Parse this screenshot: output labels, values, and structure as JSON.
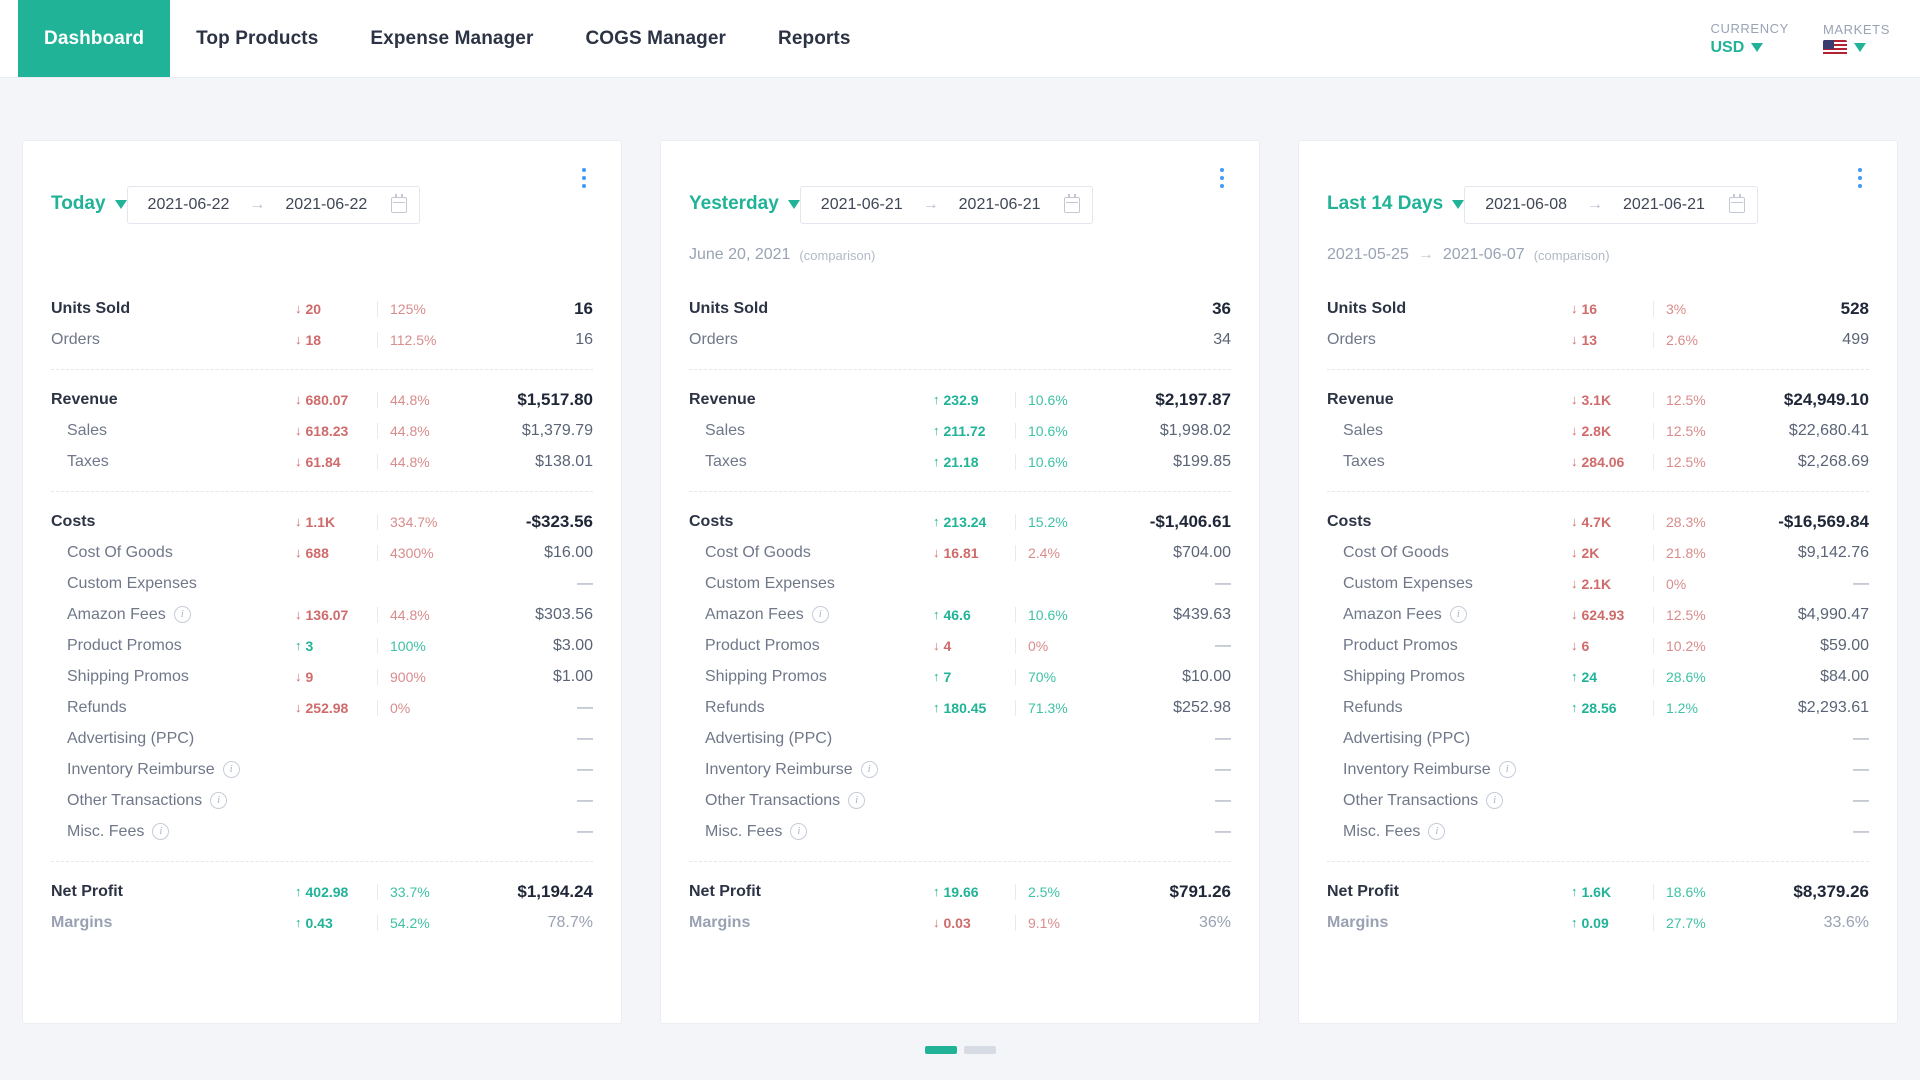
{
  "nav": {
    "tabs": [
      {
        "label": "Dashboard",
        "active": true
      },
      {
        "label": "Top Products",
        "active": false
      },
      {
        "label": "Expense Manager",
        "active": false
      },
      {
        "label": "COGS Manager",
        "active": false
      },
      {
        "label": "Reports",
        "active": false
      }
    ],
    "currency": {
      "label": "CURRENCY",
      "value": "USD"
    },
    "markets": {
      "label": "MARKETS",
      "value": "US"
    }
  },
  "colors": {
    "accent": "#20b397",
    "positive": "#20b397",
    "negative": "#cf6b6b",
    "menu_dot": "#3f9af8",
    "page_bg": "#f4f5f9"
  },
  "cards": [
    {
      "title": "Today",
      "date_from": "2021-06-22",
      "date_to": "2021-06-22",
      "range_arrow": "→",
      "comparison": null,
      "groups": [
        {
          "rows": [
            {
              "label": "Units Sold",
              "style": "main",
              "dir": "down",
              "delta": "20",
              "pct": "125%",
              "value": "16"
            },
            {
              "label": "Orders",
              "style": "sub-flat",
              "dir": "down",
              "delta": "18",
              "pct": "112.5%",
              "value": "16"
            }
          ]
        },
        {
          "rows": [
            {
              "label": "Revenue",
              "style": "main",
              "dir": "down",
              "delta": "680.07",
              "pct": "44.8%",
              "value": "$1,517.80"
            },
            {
              "label": "Sales",
              "style": "sub",
              "dir": "down",
              "delta": "618.23",
              "pct": "44.8%",
              "value": "$1,379.79"
            },
            {
              "label": "Taxes",
              "style": "sub",
              "dir": "down",
              "delta": "61.84",
              "pct": "44.8%",
              "value": "$138.01"
            }
          ]
        },
        {
          "rows": [
            {
              "label": "Costs",
              "style": "main",
              "dir": "down",
              "delta": "1.1K",
              "pct": "334.7%",
              "value": "-$323.56"
            },
            {
              "label": "Cost Of Goods",
              "style": "sub",
              "dir": "down",
              "delta": "688",
              "pct": "4300%",
              "value": "$16.00"
            },
            {
              "label": "Custom Expenses",
              "style": "sub",
              "dir": null,
              "delta": "",
              "pct": "",
              "value": "—"
            },
            {
              "label": "Amazon Fees",
              "style": "sub",
              "info": true,
              "dir": "down",
              "delta": "136.07",
              "pct": "44.8%",
              "value": "$303.56"
            },
            {
              "label": "Product Promos",
              "style": "sub",
              "dir": "up",
              "delta": "3",
              "pct": "100%",
              "value": "$3.00"
            },
            {
              "label": "Shipping Promos",
              "style": "sub",
              "dir": "down",
              "delta": "9",
              "pct": "900%",
              "value": "$1.00"
            },
            {
              "label": "Refunds",
              "style": "sub",
              "dir": "down",
              "delta": "252.98",
              "pct": "0%",
              "value": "—"
            },
            {
              "label": "Advertising (PPC)",
              "style": "sub",
              "dir": null,
              "delta": "",
              "pct": "",
              "value": "—"
            },
            {
              "label": "Inventory Reimburse",
              "style": "sub",
              "info": true,
              "dir": null,
              "delta": "",
              "pct": "",
              "value": "—"
            },
            {
              "label": "Other Transactions",
              "style": "sub",
              "info": true,
              "dir": null,
              "delta": "",
              "pct": "",
              "value": "—"
            },
            {
              "label": "Misc. Fees",
              "style": "sub",
              "info": true,
              "dir": null,
              "delta": "",
              "pct": "",
              "value": "—"
            }
          ]
        },
        {
          "rows": [
            {
              "label": "Net Profit",
              "style": "main",
              "dir": "up",
              "delta": "402.98",
              "pct": "33.7%",
              "value": "$1,194.24"
            },
            {
              "label": "Margins",
              "style": "muted",
              "dir": "up",
              "delta": "0.43",
              "pct": "54.2%",
              "value": "78.7%"
            }
          ]
        }
      ]
    },
    {
      "title": "Yesterday",
      "date_from": "2021-06-21",
      "date_to": "2021-06-21",
      "range_arrow": "→",
      "comparison": {
        "text": "June 20, 2021",
        "note": "(comparison)"
      },
      "groups": [
        {
          "rows": [
            {
              "label": "Units Sold",
              "style": "main",
              "dir": null,
              "delta": "",
              "pct": "",
              "value": "36"
            },
            {
              "label": "Orders",
              "style": "sub-flat",
              "dir": null,
              "delta": "",
              "pct": "",
              "value": "34"
            }
          ]
        },
        {
          "rows": [
            {
              "label": "Revenue",
              "style": "main",
              "dir": "up",
              "delta": "232.9",
              "pct": "10.6%",
              "value": "$2,197.87"
            },
            {
              "label": "Sales",
              "style": "sub",
              "dir": "up",
              "delta": "211.72",
              "pct": "10.6%",
              "value": "$1,998.02"
            },
            {
              "label": "Taxes",
              "style": "sub",
              "dir": "up",
              "delta": "21.18",
              "pct": "10.6%",
              "value": "$199.85"
            }
          ]
        },
        {
          "rows": [
            {
              "label": "Costs",
              "style": "main",
              "dir": "up",
              "delta": "213.24",
              "pct": "15.2%",
              "value": "-$1,406.61"
            },
            {
              "label": "Cost Of Goods",
              "style": "sub",
              "dir": "down",
              "delta": "16.81",
              "pct": "2.4%",
              "value": "$704.00"
            },
            {
              "label": "Custom Expenses",
              "style": "sub",
              "dir": null,
              "delta": "",
              "pct": "",
              "value": "—"
            },
            {
              "label": "Amazon Fees",
              "style": "sub",
              "info": true,
              "dir": "up",
              "delta": "46.6",
              "pct": "10.6%",
              "value": "$439.63"
            },
            {
              "label": "Product Promos",
              "style": "sub",
              "dir": "down",
              "delta": "4",
              "pct": "0%",
              "value": "—"
            },
            {
              "label": "Shipping Promos",
              "style": "sub",
              "dir": "up",
              "delta": "7",
              "pct": "70%",
              "value": "$10.00"
            },
            {
              "label": "Refunds",
              "style": "sub",
              "dir": "up",
              "delta": "180.45",
              "pct": "71.3%",
              "value": "$252.98"
            },
            {
              "label": "Advertising (PPC)",
              "style": "sub",
              "dir": null,
              "delta": "",
              "pct": "",
              "value": "—"
            },
            {
              "label": "Inventory Reimburse",
              "style": "sub",
              "info": true,
              "dir": null,
              "delta": "",
              "pct": "",
              "value": "—"
            },
            {
              "label": "Other Transactions",
              "style": "sub",
              "info": true,
              "dir": null,
              "delta": "",
              "pct": "",
              "value": "—"
            },
            {
              "label": "Misc. Fees",
              "style": "sub",
              "info": true,
              "dir": null,
              "delta": "",
              "pct": "",
              "value": "—"
            }
          ]
        },
        {
          "rows": [
            {
              "label": "Net Profit",
              "style": "main",
              "dir": "up",
              "delta": "19.66",
              "pct": "2.5%",
              "value": "$791.26"
            },
            {
              "label": "Margins",
              "style": "muted",
              "dir": "down",
              "delta": "0.03",
              "pct": "9.1%",
              "value": "36%"
            }
          ]
        }
      ]
    },
    {
      "title": "Last 14 Days",
      "date_from": "2021-06-08",
      "date_to": "2021-06-21",
      "range_arrow": "→",
      "comparison": {
        "text": "2021-05-25",
        "text2": "2021-06-07",
        "arrow": "→",
        "note": "(comparison)"
      },
      "groups": [
        {
          "rows": [
            {
              "label": "Units Sold",
              "style": "main",
              "dir": "down",
              "delta": "16",
              "pct": "3%",
              "value": "528"
            },
            {
              "label": "Orders",
              "style": "sub-flat",
              "dir": "down",
              "delta": "13",
              "pct": "2.6%",
              "value": "499"
            }
          ]
        },
        {
          "rows": [
            {
              "label": "Revenue",
              "style": "main",
              "dir": "down",
              "delta": "3.1K",
              "pct": "12.5%",
              "value": "$24,949.10"
            },
            {
              "label": "Sales",
              "style": "sub",
              "dir": "down",
              "delta": "2.8K",
              "pct": "12.5%",
              "value": "$22,680.41"
            },
            {
              "label": "Taxes",
              "style": "sub",
              "dir": "down",
              "delta": "284.06",
              "pct": "12.5%",
              "value": "$2,268.69"
            }
          ]
        },
        {
          "rows": [
            {
              "label": "Costs",
              "style": "main",
              "dir": "down",
              "delta": "4.7K",
              "pct": "28.3%",
              "value": "-$16,569.84"
            },
            {
              "label": "Cost Of Goods",
              "style": "sub",
              "dir": "down",
              "delta": "2K",
              "pct": "21.8%",
              "value": "$9,142.76"
            },
            {
              "label": "Custom Expenses",
              "style": "sub",
              "dir": "down",
              "delta": "2.1K",
              "pct": "0%",
              "value": "—"
            },
            {
              "label": "Amazon Fees",
              "style": "sub",
              "info": true,
              "dir": "down",
              "delta": "624.93",
              "pct": "12.5%",
              "value": "$4,990.47"
            },
            {
              "label": "Product Promos",
              "style": "sub",
              "dir": "down",
              "delta": "6",
              "pct": "10.2%",
              "value": "$59.00"
            },
            {
              "label": "Shipping Promos",
              "style": "sub",
              "dir": "up",
              "delta": "24",
              "pct": "28.6%",
              "value": "$84.00"
            },
            {
              "label": "Refunds",
              "style": "sub",
              "dir": "up",
              "delta": "28.56",
              "pct": "1.2%",
              "value": "$2,293.61"
            },
            {
              "label": "Advertising (PPC)",
              "style": "sub",
              "dir": null,
              "delta": "",
              "pct": "",
              "value": "—"
            },
            {
              "label": "Inventory Reimburse",
              "style": "sub",
              "info": true,
              "dir": null,
              "delta": "",
              "pct": "",
              "value": "—"
            },
            {
              "label": "Other Transactions",
              "style": "sub",
              "info": true,
              "dir": null,
              "delta": "",
              "pct": "",
              "value": "—"
            },
            {
              "label": "Misc. Fees",
              "style": "sub",
              "info": true,
              "dir": null,
              "delta": "",
              "pct": "",
              "value": "—"
            }
          ]
        },
        {
          "rows": [
            {
              "label": "Net Profit",
              "style": "main",
              "dir": "up",
              "delta": "1.6K",
              "pct": "18.6%",
              "value": "$8,379.26"
            },
            {
              "label": "Margins",
              "style": "muted",
              "dir": "up",
              "delta": "0.09",
              "pct": "27.7%",
              "value": "33.6%"
            }
          ]
        }
      ]
    }
  ],
  "pager": {
    "pages": [
      {
        "active": true
      },
      {
        "active": false
      }
    ]
  }
}
